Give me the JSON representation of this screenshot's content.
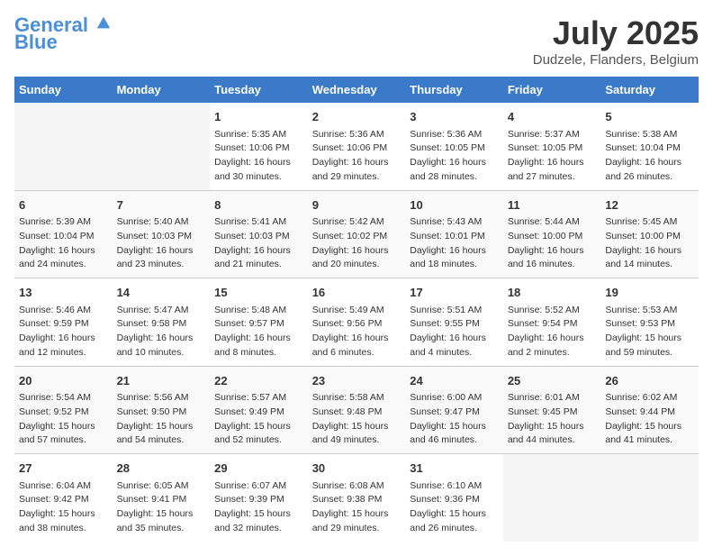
{
  "header": {
    "logo_line1": "General",
    "logo_line2": "Blue",
    "month_year": "July 2025",
    "location": "Dudzele, Flanders, Belgium"
  },
  "weekdays": [
    "Sunday",
    "Monday",
    "Tuesday",
    "Wednesday",
    "Thursday",
    "Friday",
    "Saturday"
  ],
  "rows": [
    [
      {
        "day": "",
        "empty": true
      },
      {
        "day": "",
        "empty": true
      },
      {
        "day": "1",
        "sunrise": "Sunrise: 5:35 AM",
        "sunset": "Sunset: 10:06 PM",
        "daylight": "Daylight: 16 hours and 30 minutes."
      },
      {
        "day": "2",
        "sunrise": "Sunrise: 5:36 AM",
        "sunset": "Sunset: 10:06 PM",
        "daylight": "Daylight: 16 hours and 29 minutes."
      },
      {
        "day": "3",
        "sunrise": "Sunrise: 5:36 AM",
        "sunset": "Sunset: 10:05 PM",
        "daylight": "Daylight: 16 hours and 28 minutes."
      },
      {
        "day": "4",
        "sunrise": "Sunrise: 5:37 AM",
        "sunset": "Sunset: 10:05 PM",
        "daylight": "Daylight: 16 hours and 27 minutes."
      },
      {
        "day": "5",
        "sunrise": "Sunrise: 5:38 AM",
        "sunset": "Sunset: 10:04 PM",
        "daylight": "Daylight: 16 hours and 26 minutes."
      }
    ],
    [
      {
        "day": "6",
        "sunrise": "Sunrise: 5:39 AM",
        "sunset": "Sunset: 10:04 PM",
        "daylight": "Daylight: 16 hours and 24 minutes."
      },
      {
        "day": "7",
        "sunrise": "Sunrise: 5:40 AM",
        "sunset": "Sunset: 10:03 PM",
        "daylight": "Daylight: 16 hours and 23 minutes."
      },
      {
        "day": "8",
        "sunrise": "Sunrise: 5:41 AM",
        "sunset": "Sunset: 10:03 PM",
        "daylight": "Daylight: 16 hours and 21 minutes."
      },
      {
        "day": "9",
        "sunrise": "Sunrise: 5:42 AM",
        "sunset": "Sunset: 10:02 PM",
        "daylight": "Daylight: 16 hours and 20 minutes."
      },
      {
        "day": "10",
        "sunrise": "Sunrise: 5:43 AM",
        "sunset": "Sunset: 10:01 PM",
        "daylight": "Daylight: 16 hours and 18 minutes."
      },
      {
        "day": "11",
        "sunrise": "Sunrise: 5:44 AM",
        "sunset": "Sunset: 10:00 PM",
        "daylight": "Daylight: 16 hours and 16 minutes."
      },
      {
        "day": "12",
        "sunrise": "Sunrise: 5:45 AM",
        "sunset": "Sunset: 10:00 PM",
        "daylight": "Daylight: 16 hours and 14 minutes."
      }
    ],
    [
      {
        "day": "13",
        "sunrise": "Sunrise: 5:46 AM",
        "sunset": "Sunset: 9:59 PM",
        "daylight": "Daylight: 16 hours and 12 minutes."
      },
      {
        "day": "14",
        "sunrise": "Sunrise: 5:47 AM",
        "sunset": "Sunset: 9:58 PM",
        "daylight": "Daylight: 16 hours and 10 minutes."
      },
      {
        "day": "15",
        "sunrise": "Sunrise: 5:48 AM",
        "sunset": "Sunset: 9:57 PM",
        "daylight": "Daylight: 16 hours and 8 minutes."
      },
      {
        "day": "16",
        "sunrise": "Sunrise: 5:49 AM",
        "sunset": "Sunset: 9:56 PM",
        "daylight": "Daylight: 16 hours and 6 minutes."
      },
      {
        "day": "17",
        "sunrise": "Sunrise: 5:51 AM",
        "sunset": "Sunset: 9:55 PM",
        "daylight": "Daylight: 16 hours and 4 minutes."
      },
      {
        "day": "18",
        "sunrise": "Sunrise: 5:52 AM",
        "sunset": "Sunset: 9:54 PM",
        "daylight": "Daylight: 16 hours and 2 minutes."
      },
      {
        "day": "19",
        "sunrise": "Sunrise: 5:53 AM",
        "sunset": "Sunset: 9:53 PM",
        "daylight": "Daylight: 15 hours and 59 minutes."
      }
    ],
    [
      {
        "day": "20",
        "sunrise": "Sunrise: 5:54 AM",
        "sunset": "Sunset: 9:52 PM",
        "daylight": "Daylight: 15 hours and 57 minutes."
      },
      {
        "day": "21",
        "sunrise": "Sunrise: 5:56 AM",
        "sunset": "Sunset: 9:50 PM",
        "daylight": "Daylight: 15 hours and 54 minutes."
      },
      {
        "day": "22",
        "sunrise": "Sunrise: 5:57 AM",
        "sunset": "Sunset: 9:49 PM",
        "daylight": "Daylight: 15 hours and 52 minutes."
      },
      {
        "day": "23",
        "sunrise": "Sunrise: 5:58 AM",
        "sunset": "Sunset: 9:48 PM",
        "daylight": "Daylight: 15 hours and 49 minutes."
      },
      {
        "day": "24",
        "sunrise": "Sunrise: 6:00 AM",
        "sunset": "Sunset: 9:47 PM",
        "daylight": "Daylight: 15 hours and 46 minutes."
      },
      {
        "day": "25",
        "sunrise": "Sunrise: 6:01 AM",
        "sunset": "Sunset: 9:45 PM",
        "daylight": "Daylight: 15 hours and 44 minutes."
      },
      {
        "day": "26",
        "sunrise": "Sunrise: 6:02 AM",
        "sunset": "Sunset: 9:44 PM",
        "daylight": "Daylight: 15 hours and 41 minutes."
      }
    ],
    [
      {
        "day": "27",
        "sunrise": "Sunrise: 6:04 AM",
        "sunset": "Sunset: 9:42 PM",
        "daylight": "Daylight: 15 hours and 38 minutes."
      },
      {
        "day": "28",
        "sunrise": "Sunrise: 6:05 AM",
        "sunset": "Sunset: 9:41 PM",
        "daylight": "Daylight: 15 hours and 35 minutes."
      },
      {
        "day": "29",
        "sunrise": "Sunrise: 6:07 AM",
        "sunset": "Sunset: 9:39 PM",
        "daylight": "Daylight: 15 hours and 32 minutes."
      },
      {
        "day": "30",
        "sunrise": "Sunrise: 6:08 AM",
        "sunset": "Sunset: 9:38 PM",
        "daylight": "Daylight: 15 hours and 29 minutes."
      },
      {
        "day": "31",
        "sunrise": "Sunrise: 6:10 AM",
        "sunset": "Sunset: 9:36 PM",
        "daylight": "Daylight: 15 hours and 26 minutes."
      },
      {
        "day": "",
        "empty": true
      },
      {
        "day": "",
        "empty": true
      }
    ]
  ]
}
